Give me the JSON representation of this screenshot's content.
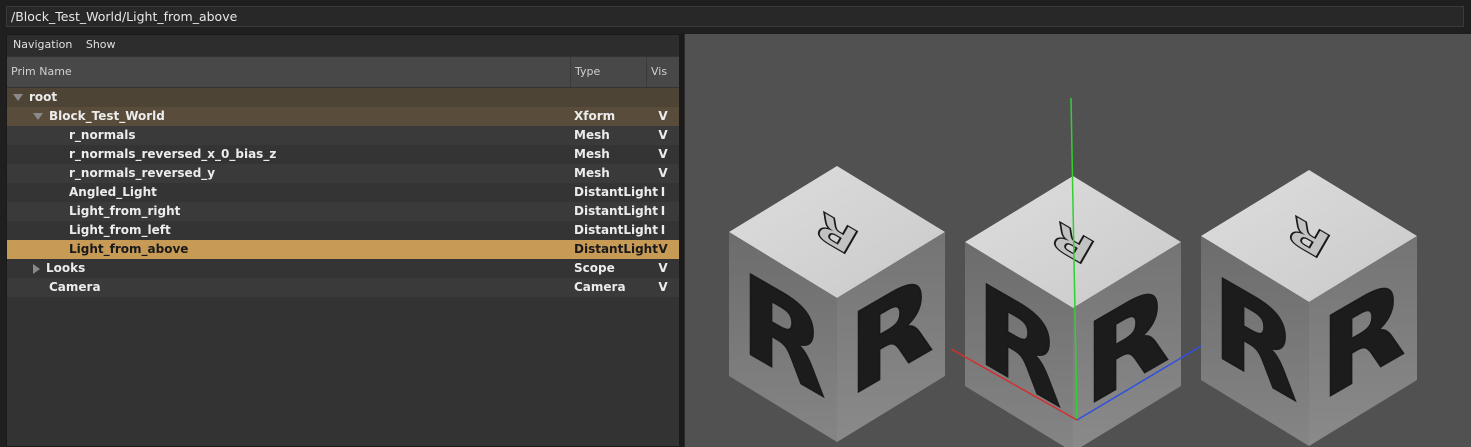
{
  "path_bar": {
    "text": "/Block_Test_World/Light_from_above"
  },
  "menu": {
    "items": [
      "Navigation",
      "Show"
    ]
  },
  "columns": {
    "name": "Prim Name",
    "type": "Type",
    "vis": "Vis"
  },
  "rows": [
    {
      "name": "root",
      "type": "",
      "vis": "",
      "depth": 0,
      "expander": "down",
      "style": "root"
    },
    {
      "name": "Block_Test_World",
      "type": "Xform",
      "vis": "V",
      "depth": 1,
      "expander": "down",
      "style": "ancestor"
    },
    {
      "name": "r_normals",
      "type": "Mesh",
      "vis": "V",
      "depth": 2,
      "expander": "none",
      "style": "a"
    },
    {
      "name": "r_normals_reversed_x_0_bias_z",
      "type": "Mesh",
      "vis": "V",
      "depth": 2,
      "expander": "none",
      "style": "b"
    },
    {
      "name": "r_normals_reversed_y",
      "type": "Mesh",
      "vis": "V",
      "depth": 2,
      "expander": "none",
      "style": "a"
    },
    {
      "name": "Angled_Light",
      "type": "DistantLight",
      "vis": "I",
      "depth": 2,
      "expander": "none",
      "style": "b"
    },
    {
      "name": "Light_from_right",
      "type": "DistantLight",
      "vis": "I",
      "depth": 2,
      "expander": "none",
      "style": "a"
    },
    {
      "name": "Light_from_left",
      "type": "DistantLight",
      "vis": "I",
      "depth": 2,
      "expander": "none",
      "style": "b"
    },
    {
      "name": "Light_from_above",
      "type": "DistantLight",
      "vis": "V",
      "depth": 2,
      "expander": "none",
      "style": "selected"
    },
    {
      "name": "Looks",
      "type": "Scope",
      "vis": "V",
      "depth": 1,
      "expander": "right",
      "style": "b"
    },
    {
      "name": "Camera",
      "type": "Camera",
      "vis": "V",
      "depth": 1,
      "expander": "none",
      "style": "a"
    }
  ],
  "colors": {
    "selected": "#c79a56",
    "ancestor": "#5a4c3a",
    "root": "#4e4436",
    "row_a": "#3a3a3a",
    "row_b": "#343434",
    "axis_x": "#d03030",
    "axis_y": "#30d030",
    "axis_z": "#3050e0"
  },
  "viewport": {
    "glyph": "R",
    "cube_count": 3
  }
}
